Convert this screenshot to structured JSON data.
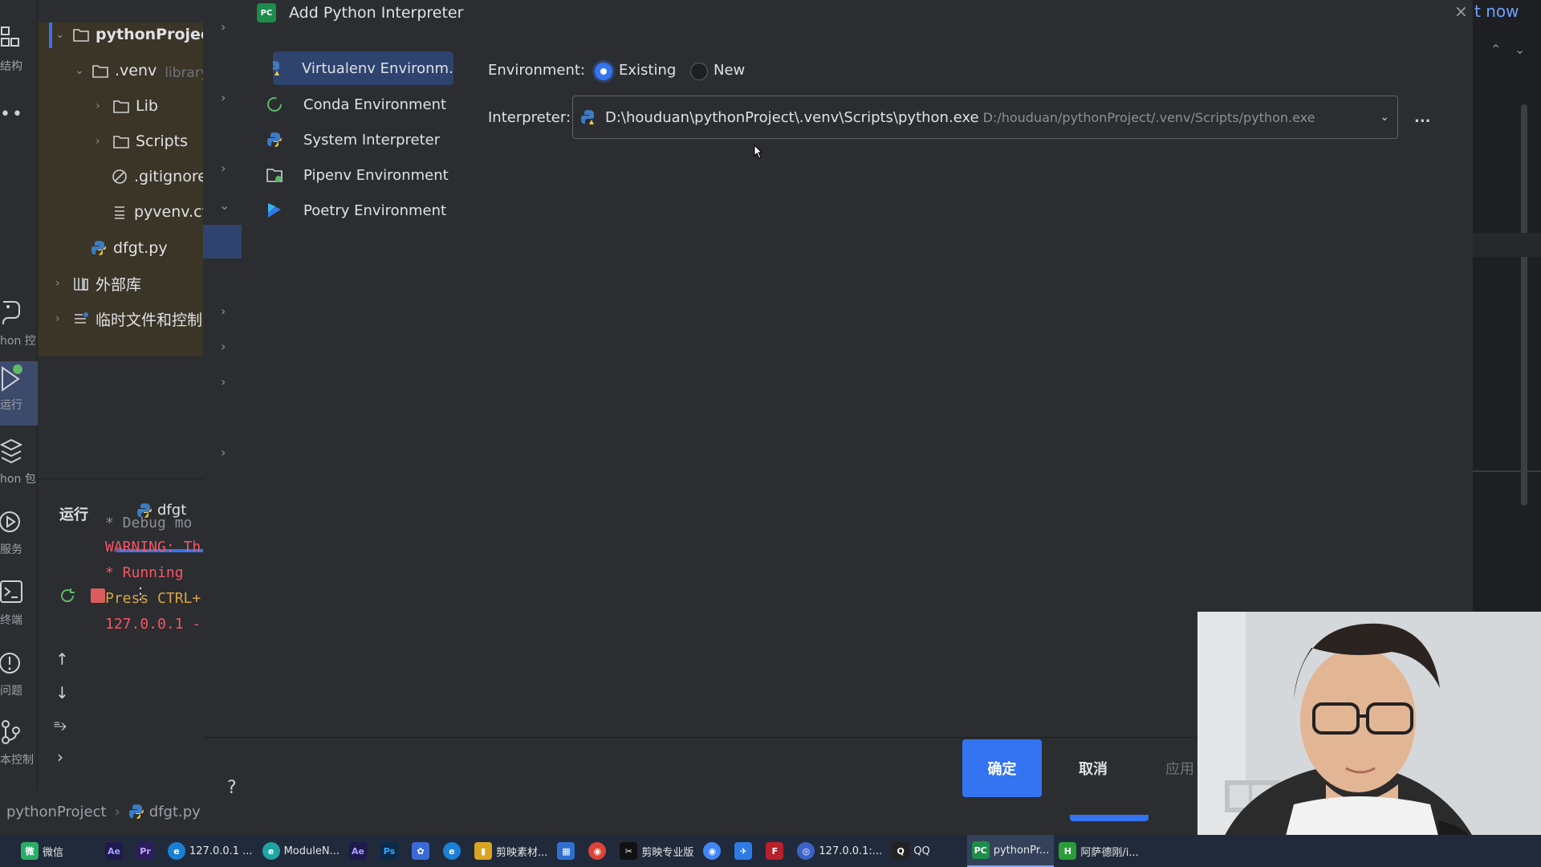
{
  "activity": {
    "items": [
      {
        "label": "结构"
      },
      {
        "label": "hon 控"
      },
      {
        "label": "运行"
      },
      {
        "label": "hon 包"
      },
      {
        "label": "服务"
      },
      {
        "label": "终端"
      },
      {
        "label": "问题"
      },
      {
        "label": "本控制"
      }
    ]
  },
  "project_tree": {
    "root": "pythonProject",
    "venv": ".venv",
    "venv_suffix": "library根",
    "lib": "Lib",
    "scripts": "Scripts",
    "gitignore": ".gitignore",
    "pyvenv": "pyvenv.cfg",
    "dfgt": "dfgt.py",
    "external": "外部库",
    "scratches": "临时文件和控制台"
  },
  "run": {
    "tab_run": "运行",
    "tab_config": "dfgt",
    "console": [
      {
        "text": "* Debug mo",
        "color": "#8c8f96"
      },
      {
        "text": "WARNING: Th",
        "color": "#f75464"
      },
      {
        "text": " * Running",
        "color": "#f75464"
      },
      {
        "text": "Press CTRL+",
        "color": "#f75464"
      },
      {
        "text": "127.0.0.1 -",
        "color": "#f75464"
      }
    ]
  },
  "breadcrumb": {
    "project": "pythonProject",
    "file": "dfgt.py"
  },
  "dialog": {
    "title": "Add Python Interpreter",
    "nav": [
      {
        "label": "Virtualenv Environm...",
        "icon": "virtualenv-icon"
      },
      {
        "label": "Conda Environment",
        "icon": "conda-icon"
      },
      {
        "label": "System Interpreter",
        "icon": "python-icon"
      },
      {
        "label": "Pipenv Environment",
        "icon": "pipenv-icon"
      },
      {
        "label": "Poetry Environment",
        "icon": "poetry-icon"
      }
    ],
    "environment_label": "Environment:",
    "radio_existing": "Existing",
    "radio_new": "New",
    "interpreter_label": "Interpreter:",
    "interpreter_path": "D:\\houduan\\pythonProject\\.venv\\Scripts\\python.exe",
    "interpreter_hint": "D:/houduan/pythonProject/.venv/Scripts/python.exe",
    "browse": "..."
  },
  "footer": {
    "ok": "确定",
    "cancel": "取消",
    "apply": "应用",
    "help": "?"
  },
  "top_right": {
    "label": "t now"
  },
  "taskbar": [
    {
      "label": "微信",
      "icon_text": "微",
      "color": "#2aae67"
    },
    {
      "label": "",
      "icon_text": "Ae",
      "color": "#1f1a4d"
    },
    {
      "label": "",
      "icon_text": "Pr",
      "color": "#2a1f5c"
    },
    {
      "label": "127.0.0.1 ...",
      "icon_text": "e",
      "color": "#1b7fd6"
    },
    {
      "label": "ModuleN...",
      "icon_text": "e",
      "color": "#1fa3a3"
    },
    {
      "label": "",
      "icon_text": "Ae",
      "color": "#1f1a4d"
    },
    {
      "label": "",
      "icon_text": "Ps",
      "color": "#0b2a4a"
    },
    {
      "label": "",
      "icon_text": "✿",
      "color": "#3a6ad6"
    },
    {
      "label": "",
      "icon_text": "e",
      "color": "#1b7fd6"
    },
    {
      "label": "剪映素材...",
      "icon_text": "▮",
      "color": "#d9a520"
    },
    {
      "label": "",
      "icon_text": "▦",
      "color": "#2f6fd1"
    },
    {
      "label": "",
      "icon_text": "◉",
      "color": "#db4437"
    },
    {
      "label": "剪映专业版",
      "icon_text": "✂",
      "color": "#111111"
    },
    {
      "label": "",
      "icon_text": "◉",
      "color": "#4285f4"
    },
    {
      "label": "",
      "icon_text": "✈",
      "color": "#2f7be6"
    },
    {
      "label": "",
      "icon_text": "F",
      "color": "#b8202a"
    },
    {
      "label": "127.0.0.1:...",
      "icon_text": "◎",
      "color": "#3b62c9"
    },
    {
      "label": "QQ",
      "icon_text": "Q",
      "color": "#222222"
    },
    {
      "label": "pythonPr...",
      "icon_text": "PC",
      "color": "#1e8c4a"
    },
    {
      "label": "阿萨德刚/i...",
      "icon_text": "H",
      "color": "#2a9d3a"
    }
  ]
}
